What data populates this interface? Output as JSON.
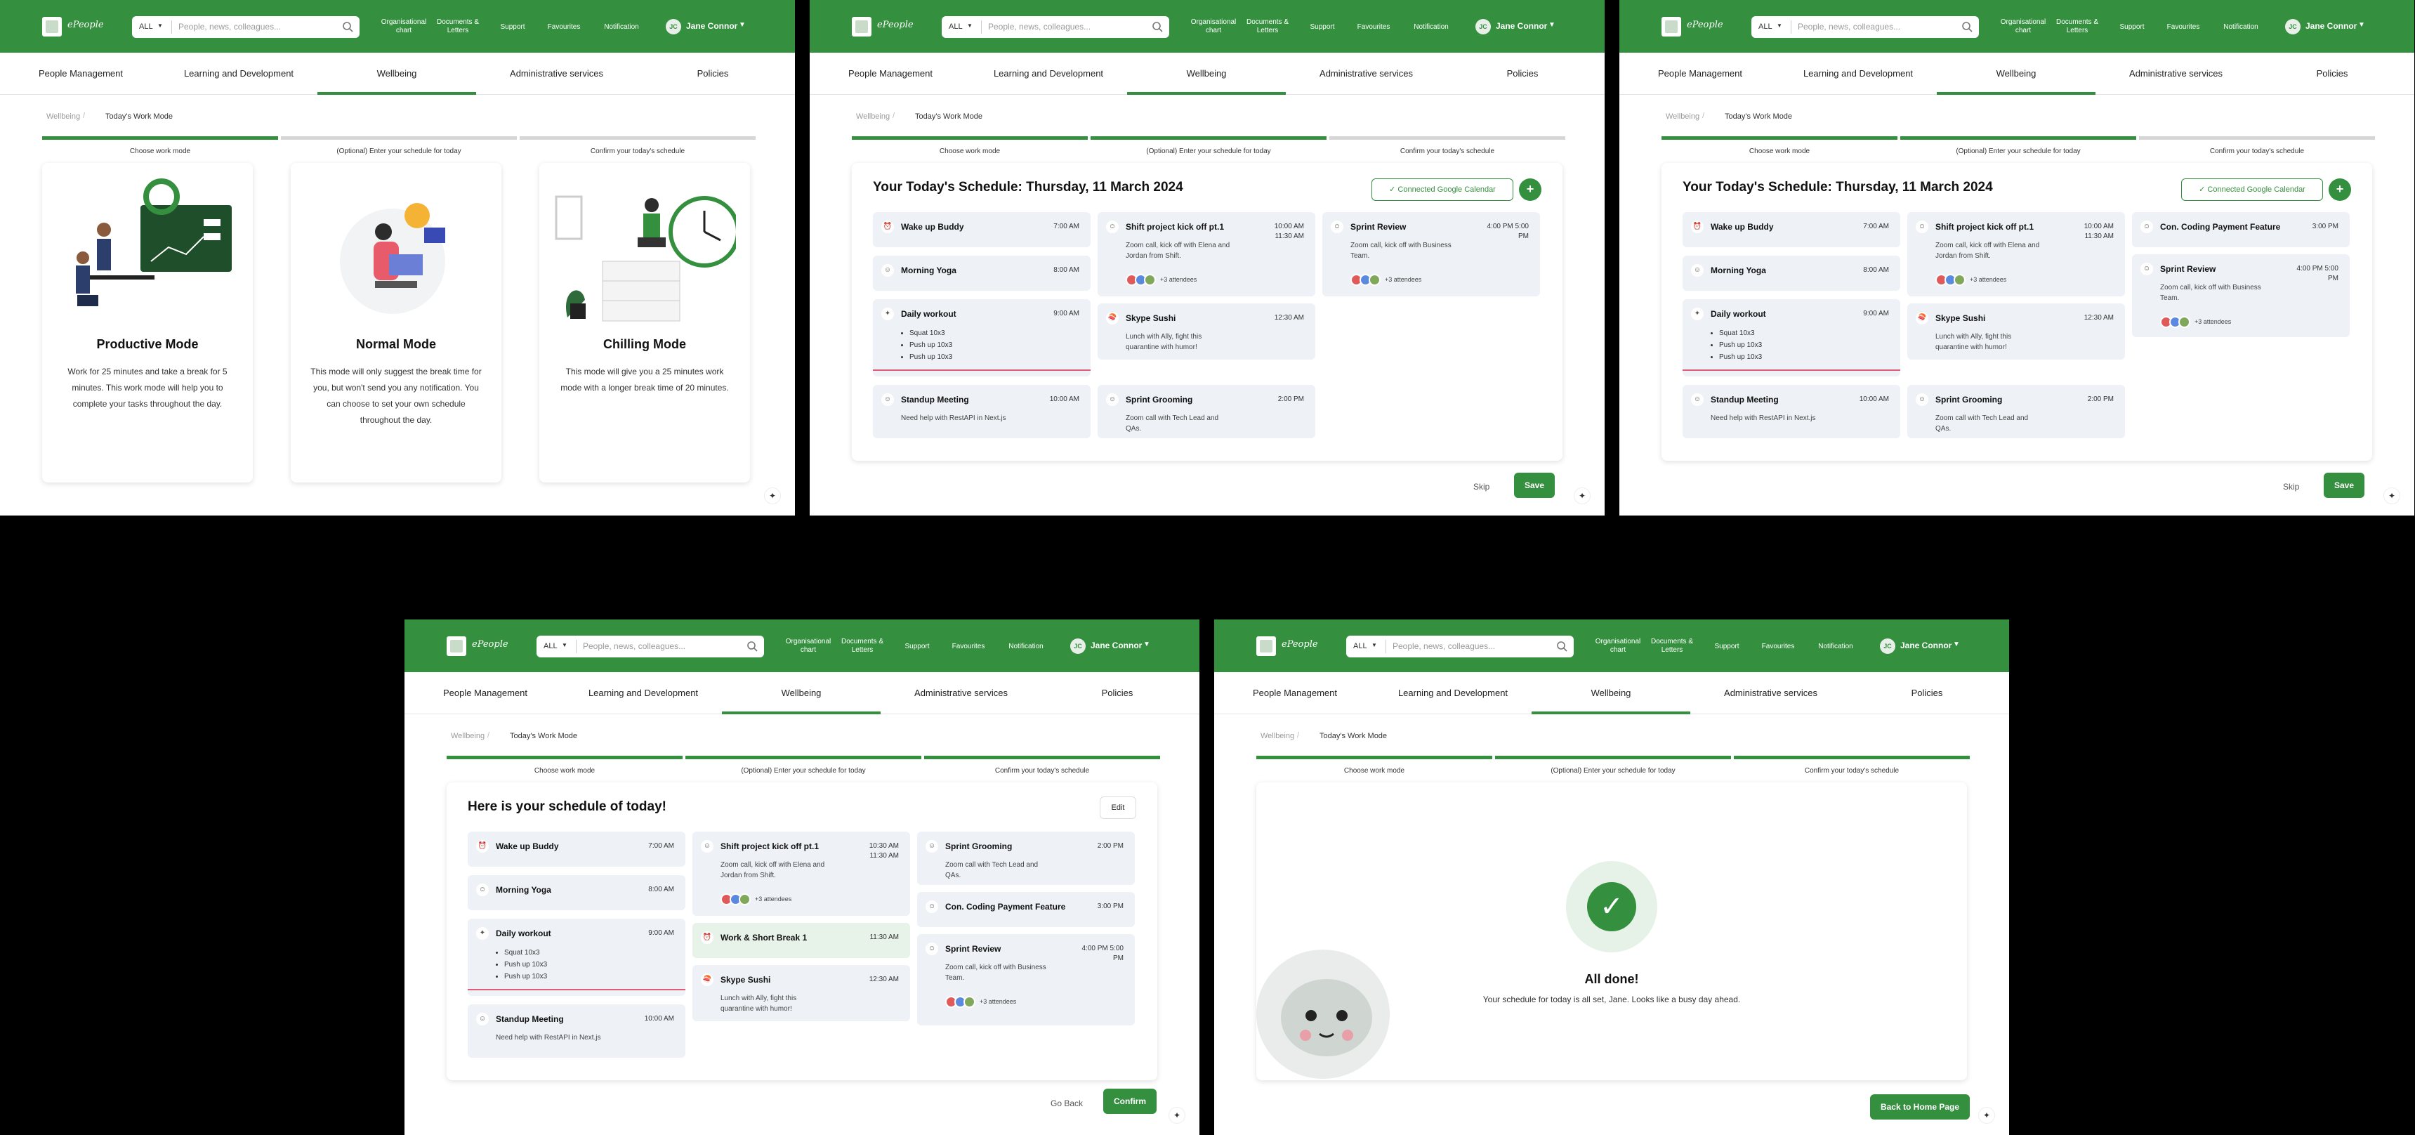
{
  "header": {
    "brand": "ePeople",
    "search_scope": "ALL",
    "search_placeholder": "People, news, colleagues...",
    "nav_org": "Organisational chart",
    "nav_docs": "Documents & Letters",
    "nav_support": "Support",
    "nav_fav": "Favourites",
    "nav_notif": "Notification",
    "user_initials": "JC",
    "user_name": "Jane Connor"
  },
  "tabs": [
    "People Management",
    "Learning and Development",
    "Wellbeing",
    "Administrative services",
    "Policies"
  ],
  "breadcrumb": {
    "parent": "Wellbeing",
    "current": "Today's Work Mode"
  },
  "steps": [
    "Choose work mode",
    "(Optional) Enter your schedule for today",
    "Confirm your today's schedule"
  ],
  "modes": [
    {
      "title": "Productive Mode",
      "desc": "Work for 25 minutes and take a break for 5 minutes. This work mode will help you to complete your tasks throughout the day."
    },
    {
      "title": "Normal Mode",
      "desc": "This mode will only suggest the break time for you, but won't send you any notification. You can choose to set your own schedule throughout the day."
    },
    {
      "title": "Chilling Mode",
      "desc": "This mode will give you a 25 minutes work mode with a longer break time of 20 minutes."
    }
  ],
  "schedule": {
    "title": "Your Today's Schedule: Thursday, 11 March 2024",
    "gcal": "Connected Google Calendar",
    "plus": "+",
    "confirm_title": "Here is your schedule of today!",
    "edit": "Edit"
  },
  "events": {
    "wake": {
      "title": "Wake up Buddy",
      "time": "7:00 AM"
    },
    "yoga": {
      "title": "Morning Yoga",
      "time": "8:00 AM"
    },
    "workout": {
      "title": "Daily workout",
      "time": "9:00 AM",
      "items": [
        "Squat 10x3",
        "Push up 10x3",
        "Push up 10x3"
      ]
    },
    "standup": {
      "title": "Standup Meeting",
      "time": "10:00 AM",
      "desc": "Need help with RestAPI in Next.js"
    },
    "shift": {
      "title": "Shift project kick off pt.1",
      "time": "10:00 AM 11:30 AM",
      "time_c": "10:30 AM 11:30 AM",
      "desc": "Zoom call, kick off with Elena and Jordan from Shift.",
      "att": "+3 attendees"
    },
    "skype": {
      "title": "Skype Sushi",
      "time": "12:30 AM",
      "desc": "Lunch with Ally, fight this quarantine with humor!"
    },
    "grooming": {
      "title": "Sprint Grooming",
      "time": "2:00 PM",
      "desc": "Zoom call with Tech Lead and QAs."
    },
    "review": {
      "title": "Sprint Review",
      "time": "4:00 PM 5:00 PM",
      "desc": "Zoom call, kick off with Business Team.",
      "att": "+3 attendees"
    },
    "coding": {
      "title": "Con. Coding Payment Feature",
      "time": "3:00 PM"
    },
    "break": {
      "title": "Work & Short Break 1",
      "time": "11:30 AM"
    }
  },
  "actions": {
    "skip": "Skip",
    "save": "Save",
    "back": "Go Back",
    "confirm": "Confirm",
    "home": "Back to Home Page"
  },
  "done": {
    "title": "All done!",
    "msg": "Your schedule for today is all set, Jane. Looks like a busy day ahead."
  },
  "icons": {
    "dots": "sparkle-icon",
    "check": "check-icon",
    "search": "search-icon"
  },
  "colors": {
    "brand": "#34903f",
    "event_bg": "#eef1f6",
    "highlight": "#e05a7a"
  }
}
